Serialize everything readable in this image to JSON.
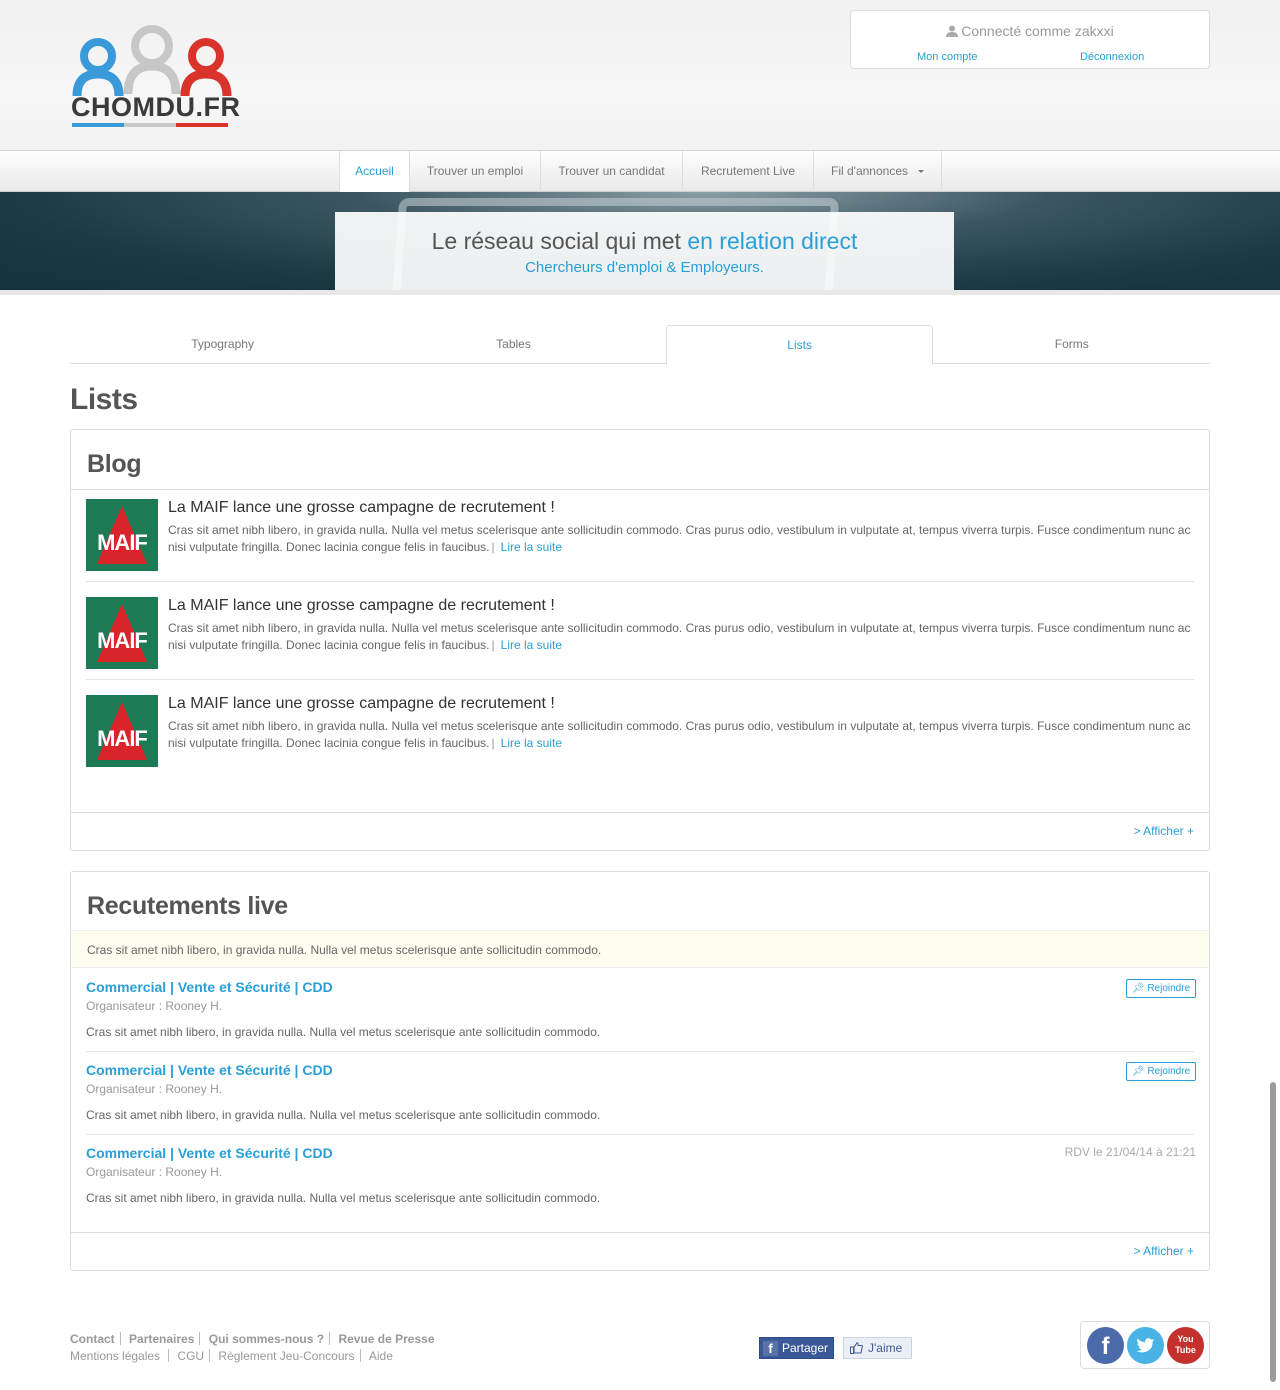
{
  "logo": {
    "text": "CHOMDU.FR",
    "colors": {
      "blue": "#3a9ad9",
      "grey": "#c9c9c9",
      "red": "#d9342b"
    }
  },
  "account": {
    "status": "Connecté comme zakxxi",
    "my_account": "Mon compte",
    "logout": "Déconnexion"
  },
  "nav": {
    "items": [
      {
        "label": "Accueil",
        "active": true
      },
      {
        "label": "Trouver un emploi"
      },
      {
        "label": "Trouver un candidat"
      },
      {
        "label": "Recrutement Live"
      },
      {
        "label": "Fil d'annonces",
        "dropdown": true
      }
    ]
  },
  "banner": {
    "line1_prefix": "Le réseau social qui met ",
    "line1_highlight": "en relation direct",
    "line2": "Chercheurs d'emploi & Employeurs."
  },
  "tabs": [
    {
      "label": "Typography"
    },
    {
      "label": "Tables"
    },
    {
      "label": "Lists",
      "active": true
    },
    {
      "label": "Forms"
    }
  ],
  "page_title": "Lists",
  "blog": {
    "title": "Blog",
    "items": [
      {
        "logo_text": "MAIF",
        "title": "La MAIF lance une grosse campagne de recrutement !",
        "text": "Cras sit amet nibh libero, in gravida nulla. Nulla vel metus scelerisque ante sollicitudin commodo. Cras purus odio, vestibulum in vulputate at, tempus viverra turpis. Fusce condimentum nunc ac nisi vulputate fringilla. Donec lacinia congue felis in faucibus.",
        "read_more": "Lire la suite"
      },
      {
        "logo_text": "MAIF",
        "title": "La MAIF lance une grosse campagne de recrutement !",
        "text": "Cras sit amet nibh libero, in gravida nulla. Nulla vel metus scelerisque ante sollicitudin commodo. Cras purus odio, vestibulum in vulputate at, tempus viverra turpis. Fusce condimentum nunc ac nisi vulputate fringilla. Donec lacinia congue felis in faucibus.",
        "read_more": "Lire la suite"
      },
      {
        "logo_text": "MAIF",
        "title": "La MAIF lance une grosse campagne de recrutement !",
        "text": "Cras sit amet nibh libero, in gravida nulla. Nulla vel metus scelerisque ante sollicitudin commodo. Cras purus odio, vestibulum in vulputate at, tempus viverra turpis. Fusce condimentum nunc ac nisi vulputate fringilla. Donec lacinia congue felis in faucibus.",
        "read_more": "Lire la suite"
      }
    ],
    "show_more": "> Afficher +"
  },
  "live": {
    "title": "Recutements live",
    "notice": "Cras sit amet nibh libero, in gravida nulla. Nulla vel metus scelerisque ante sollicitudin commodo.",
    "items": [
      {
        "title": "Commercial | Vente et Sécurité | CDD",
        "organizer": "Organisateur : Rooney H.",
        "desc": "Cras sit amet nibh libero, in gravida nulla. Nulla vel metus scelerisque ante sollicitudin commodo.",
        "action": "Rejoindre"
      },
      {
        "title": "Commercial | Vente et Sécurité | CDD",
        "organizer": "Organisateur : Rooney H.",
        "desc": "Cras sit amet nibh libero, in gravida nulla. Nulla vel metus scelerisque ante sollicitudin commodo.",
        "action": "Rejoindre"
      },
      {
        "title": "Commercial | Vente et Sécurité | CDD",
        "organizer": "Organisateur : Rooney H.",
        "desc": "Cras sit amet nibh libero, in gravida nulla. Nulla vel metus scelerisque ante sollicitudin commodo.",
        "rdv": "RDV le 21/04/14 à 21:21"
      }
    ],
    "show_more": "> Afficher +"
  },
  "footer": {
    "row1": [
      "Contact",
      "Partenaires",
      "Qui sommes-nous ?",
      "Revue de Presse"
    ],
    "row2": [
      "Mentions légales",
      "CGU",
      "Règlement Jeu-Concours",
      "Aide"
    ],
    "share": "Partager",
    "like": "J'aime",
    "social": [
      {
        "icon": "facebook-icon",
        "glyph": "f"
      },
      {
        "icon": "twitter-icon",
        "glyph": ""
      },
      {
        "icon": "youtube-icon",
        "glyph": "You Tube"
      }
    ]
  }
}
